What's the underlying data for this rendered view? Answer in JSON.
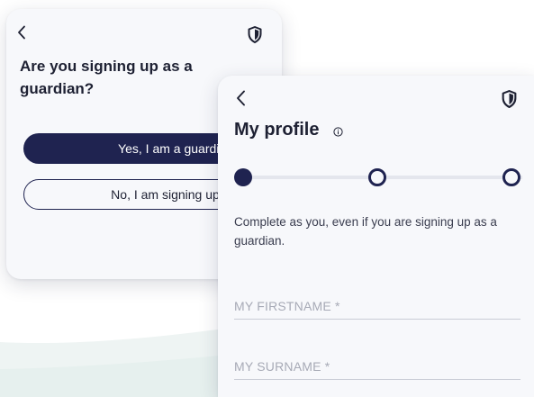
{
  "guardian_card": {
    "question": "Are you signing up as a guardian?",
    "yes_label": "Yes, I am a guardian",
    "no_label": "No, I am signing up as myself"
  },
  "profile_card": {
    "title": "My profile",
    "stepper": {
      "total_steps": 3,
      "current_step": 1
    },
    "helper_text": "Complete as you, even if you are signing up as a guardian.",
    "firstname_placeholder": "MY FIRSTNAME *",
    "surname_placeholder": "MY SURNAME *"
  },
  "icons": {
    "back": "chevron-left-icon",
    "shield": "shield-icon",
    "info": "info-icon"
  },
  "colors": {
    "primary": "#1f2350",
    "card_bg": "#f7f8fb",
    "text": "#1e2133",
    "placeholder": "#a7aab6",
    "divider": "#c9ccd6"
  }
}
